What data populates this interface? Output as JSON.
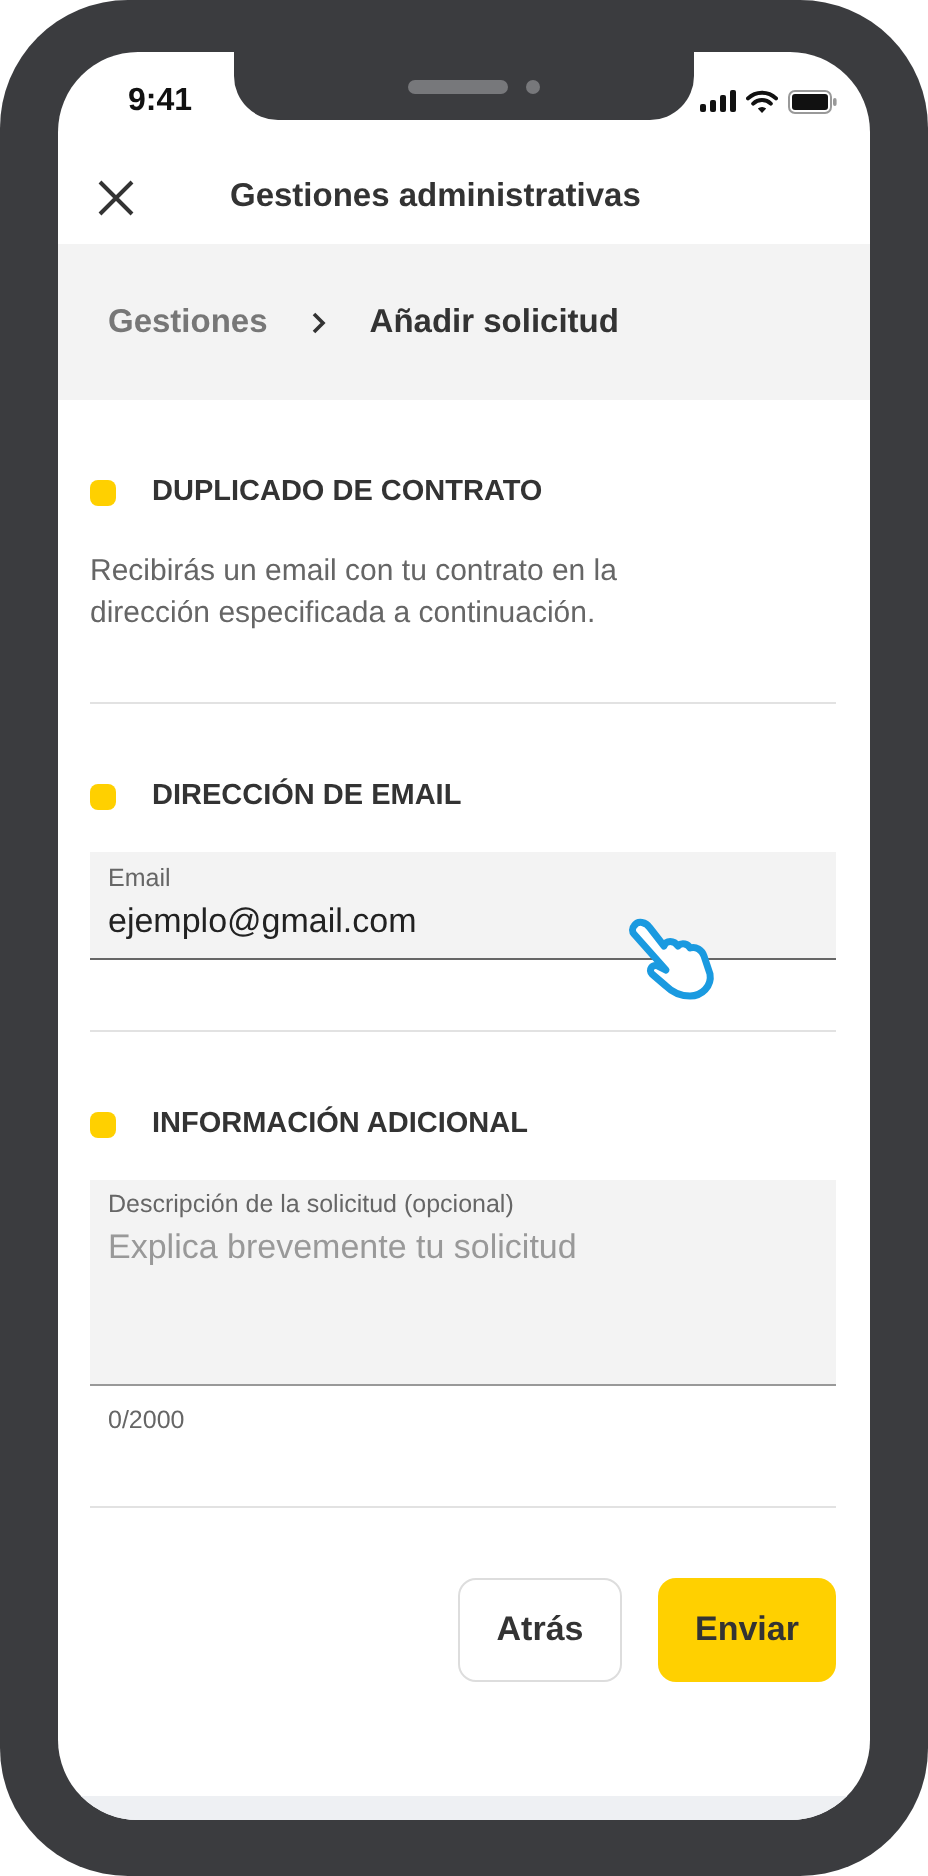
{
  "status_bar": {
    "time": "9:41"
  },
  "header": {
    "title": "Gestiones administrativas"
  },
  "breadcrumb": [
    {
      "label": "Gestiones",
      "selected": false
    },
    {
      "label": "Añadir solicitud",
      "selected": true
    }
  ],
  "sections": [
    {
      "kind": "text",
      "title": "DUPLICADO DE CONTRATO",
      "color": "#ffd000",
      "text": "Recibirás un email con tu contrato en la dirección especificada a continuación."
    },
    {
      "kind": "field",
      "title": "DIRECCIÓN DE EMAIL",
      "color": "#ffd000",
      "label": "Email",
      "value": "ejemplo@gmail.com"
    },
    {
      "kind": "textarea",
      "title": "INFORMACIÓN ADICIONAL",
      "color": "#ffd000",
      "label": "Descripción de la solicitud (opcional)",
      "placeholder": "Explica brevemente tu solicitud",
      "counter": "0/2000"
    }
  ],
  "buttons": [
    {
      "label": "Atrás",
      "kind": "secondary"
    },
    {
      "label": "Enviar",
      "kind": "primary"
    }
  ]
}
